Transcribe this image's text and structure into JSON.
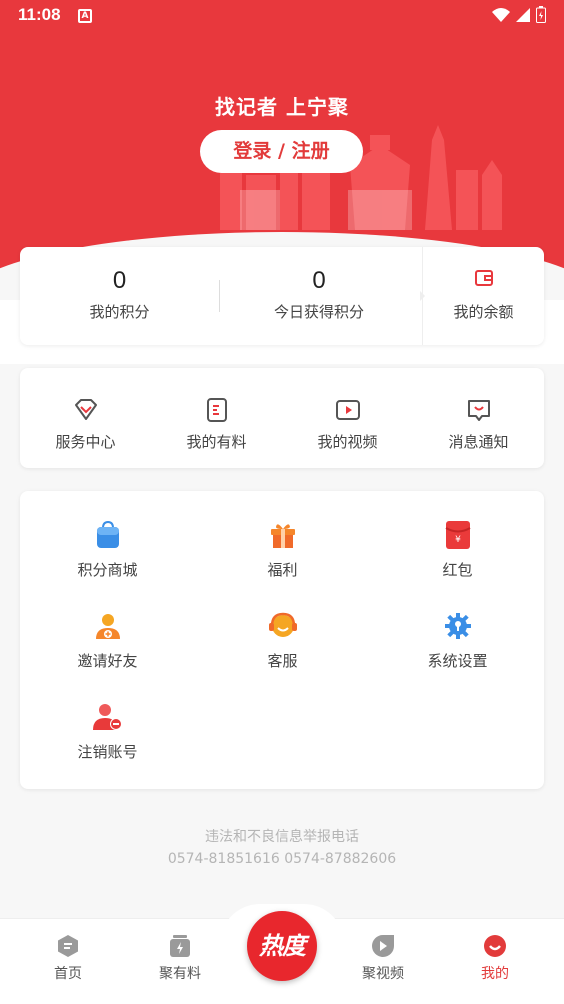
{
  "status_bar": {
    "time": "11:08",
    "app_badge": "A"
  },
  "header": {
    "slogan": "找记者 上宁聚",
    "login_label": "登录 / 注册"
  },
  "points": {
    "my_points_value": "0",
    "my_points_label": "我的积分",
    "today_points_value": "0",
    "today_points_label": "今日获得积分",
    "balance_label": "我的余额"
  },
  "services": [
    {
      "label": "服务中心",
      "icon": "diamond-icon"
    },
    {
      "label": "我的有料",
      "icon": "document-icon"
    },
    {
      "label": "我的视频",
      "icon": "video-icon"
    },
    {
      "label": "消息通知",
      "icon": "message-icon"
    }
  ],
  "tools": [
    {
      "label": "积分商城",
      "icon": "shopping-bag-icon"
    },
    {
      "label": "福利",
      "icon": "gift-icon"
    },
    {
      "label": "红包",
      "icon": "red-packet-icon"
    },
    {
      "label": "邀请好友",
      "icon": "add-friend-icon"
    },
    {
      "label": "客服",
      "icon": "customer-service-icon"
    },
    {
      "label": "系统设置",
      "icon": "settings-gear-icon"
    },
    {
      "label": "注销账号",
      "icon": "delete-account-icon"
    }
  ],
  "footer": {
    "line1": "违法和不良信息举报电话",
    "line2": "0574-81851616 0574-87882606"
  },
  "tabbar": {
    "home": "首页",
    "materials": "聚有料",
    "center": "热度",
    "video": "聚视频",
    "mine": "我的"
  },
  "colors": {
    "brand_red": "#e8383d",
    "active_tab": "#e23b3b",
    "blue": "#3a8ee6",
    "orange": "#f5862b"
  }
}
